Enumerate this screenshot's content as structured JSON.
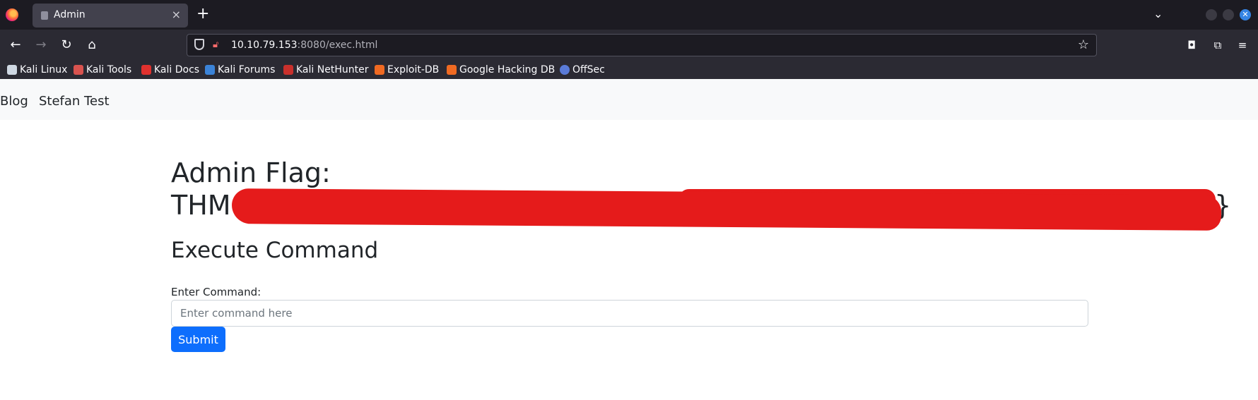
{
  "browser": {
    "tab": {
      "title": "Admin",
      "close_symbol": "×"
    },
    "new_tab_symbol": "+",
    "tab_list_symbol": "⌄",
    "nav": {
      "back": "←",
      "forward": "→",
      "reload": "↻",
      "home": "⌂"
    },
    "url": {
      "host": "10.10.79.153",
      "rest": ":8080/exec.html"
    },
    "tools": {
      "pocket": "◘",
      "extensions": "⧉",
      "menu": "≡",
      "star": "☆"
    },
    "bookmarks": [
      {
        "label": "Kali Linux",
        "icon": "kali-dragon-icon",
        "color": "#cfd8e3"
      },
      {
        "label": "Kali Tools",
        "icon": "kali-tools-icon",
        "color": "#d9534f"
      },
      {
        "label": "Kali Docs",
        "icon": "kali-docs-icon",
        "color": "#e0312e"
      },
      {
        "label": "Kali Forums",
        "icon": "kali-forums-icon",
        "color": "#3b83d8"
      },
      {
        "label": "Kali NetHunter",
        "icon": "kali-nethunter-icon",
        "color": "#c9302c"
      },
      {
        "label": "Exploit-DB",
        "icon": "exploit-db-icon",
        "color": "#f06a22"
      },
      {
        "label": "Google Hacking DB",
        "icon": "ghdb-icon",
        "color": "#f06a22"
      },
      {
        "label": "OffSec",
        "icon": "offsec-icon",
        "color": "#5a7bd8"
      }
    ]
  },
  "site": {
    "nav": {
      "blog": "Blog",
      "stefan": "Stefan Test"
    },
    "flag_heading": "Admin Flag:",
    "flag_value": "THM{",
    "flag_end": "}",
    "exec_heading": "Execute Command",
    "command_label": "Enter Command:",
    "command_placeholder": "Enter command here",
    "submit_label": "Submit"
  },
  "colors": {
    "primary": "#0d6efd",
    "redaction": "#e51b1b"
  }
}
